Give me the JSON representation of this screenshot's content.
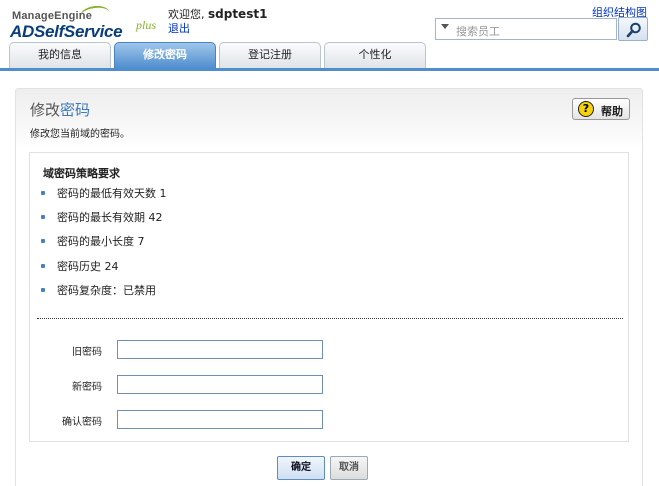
{
  "header": {
    "brand_small": "ManageEngine",
    "brand_main": "ADSelfService",
    "brand_plus": "plus",
    "welcome_prefix": "欢迎您,",
    "username": "sdptest1",
    "logout_label": "退出",
    "org_chart_link": "组织结构图",
    "search_placeholder": "搜索员工",
    "search_icon": "magnifier-icon"
  },
  "tabs": [
    {
      "label": "我的信息",
      "active": false
    },
    {
      "label": "修改密码",
      "active": true
    },
    {
      "label": "登记注册",
      "active": false
    },
    {
      "label": "个性化",
      "active": false
    }
  ],
  "page": {
    "title_part1": "修改",
    "title_part2": "密码",
    "subtitle": "修改您当前域的密码。",
    "help_label": "帮助",
    "help_icon_glyph": "?"
  },
  "policy": {
    "heading": "域密码策略要求",
    "items": [
      "密码的最低有效天数 1",
      "密码的最长有效期 42",
      "密码的最小长度 7",
      "密码历史 24",
      "密码复杂度：已禁用"
    ]
  },
  "form": {
    "old_password_label": "旧密码",
    "new_password_label": "新密码",
    "confirm_password_label": "确认密码",
    "old_password_value": "",
    "new_password_value": "",
    "confirm_password_value": ""
  },
  "actions": {
    "ok_label": "确定",
    "cancel_label": "取消"
  },
  "colors": {
    "accent": "#4f8dcd",
    "brand_blue": "#0a3d7c",
    "brand_green": "#86b32c",
    "link": "#0033cc"
  }
}
